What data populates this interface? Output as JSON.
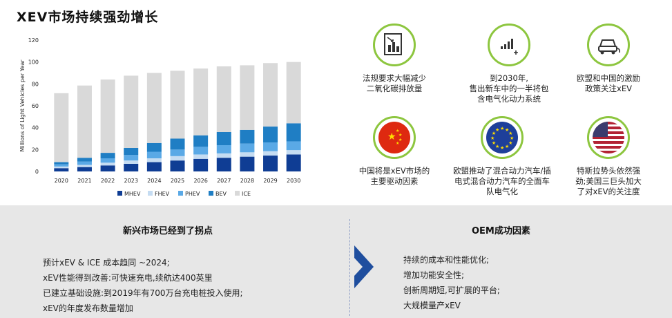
{
  "title": "XEV市场持续强劲增长",
  "colors": {
    "MHEV": "#0f3d94",
    "FHEV": "#c5dcf2",
    "PHEV": "#5aa9e6",
    "BEV": "#1f7ec4",
    "ICE": "#d9d9d9",
    "accent_ring": "#8dc63f",
    "arrow": "#1f4e9e",
    "panel_bg": "#e7e7e7"
  },
  "chart_data": {
    "type": "bar",
    "stacked": true,
    "categories": [
      "2020",
      "2021",
      "2022",
      "2023",
      "2024",
      "2025",
      "2026",
      "2027",
      "2028",
      "2029",
      "2030"
    ],
    "ylabel": "Millions of Light Vehicles per Year",
    "xlabel": "",
    "ylim": [
      0,
      120
    ],
    "yticks": [
      0,
      20,
      40,
      60,
      80,
      100,
      120
    ],
    "grid": false,
    "legend_position": "bottom",
    "series": [
      {
        "name": "MHEV",
        "values": [
          3,
          4,
          5.5,
          7,
          8.5,
          10,
          11.5,
          12.5,
          13.5,
          14.5,
          15.5
        ]
      },
      {
        "name": "FHEV",
        "values": [
          1.5,
          2,
          2.5,
          3,
          3.5,
          4,
          4,
          4,
          4,
          4,
          4
        ]
      },
      {
        "name": "PHEV",
        "values": [
          2,
          3,
          4,
          5,
          6,
          6,
          7,
          7.5,
          8,
          8,
          8
        ]
      },
      {
        "name": "BEV",
        "values": [
          2,
          3.5,
          5,
          6.5,
          8,
          10,
          10.5,
          12,
          12.5,
          14.5,
          16.5
        ]
      },
      {
        "name": "ICE",
        "values": [
          63,
          66,
          67,
          66,
          64,
          62,
          61,
          60,
          59,
          58,
          56
        ]
      }
    ]
  },
  "icons": [
    {
      "name": "regulation",
      "text": "法规要求大幅减少\n二氧化碳排放量"
    },
    {
      "name": "sales-signal",
      "text": "到2030年,\n售出新车中的一半将包\n含电气化动力系统"
    },
    {
      "name": "ev-car",
      "text": "欧盟和中国的激励\n政策关注xEV"
    },
    {
      "name": "china-flag",
      "text": "中国将是xEV市场的\n主要驱动因素"
    },
    {
      "name": "eu-flag",
      "text": "欧盟推动了混合动力汽车/插\n电式混合动力汽车的全面车\n队电气化"
    },
    {
      "name": "us-flag",
      "text": "特斯拉势头依然强\n劲;美国三巨头加大\n了对xEV的关注度"
    }
  ],
  "left_panel": {
    "title": "新兴市场已经到了拐点",
    "items": [
      "预计xEV & ICE 成本趋同 ~2024;",
      "xEV性能得到改善:可快速充电,续航达400英里",
      "已建立基础设施:到2019年有700万台充电桩投入使用;",
      "xEV的年度发布数量增加"
    ]
  },
  "right_panel": {
    "title": "OEM成功因素",
    "items": [
      "持续的成本和性能优化;",
      "增加功能安全性;",
      "创新周期短,可扩展的平台;",
      "大规模量产xEV"
    ]
  }
}
